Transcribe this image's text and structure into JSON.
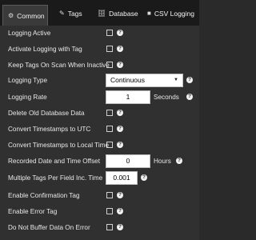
{
  "tabs": [
    {
      "label": "Common",
      "icon": "gear-icon",
      "glyph": "⚙",
      "active": true
    },
    {
      "label": "Tags",
      "icon": "tag-icon",
      "glyph": "✎",
      "active": false
    },
    {
      "label": "Database",
      "icon": "database-icon",
      "glyph": "🗄",
      "active": false
    },
    {
      "label": "CSV Logging",
      "icon": "csv-icon",
      "glyph": "■",
      "active": false
    }
  ],
  "settings": {
    "logging_active": {
      "label": "Logging Active",
      "checked": false
    },
    "activate_logging_with_tag": {
      "label": "Activate Logging with Tag",
      "checked": false
    },
    "keep_tags_on_scan": {
      "label": "Keep Tags On Scan When Inactive",
      "checked": false
    },
    "logging_type": {
      "label": "Logging Type",
      "value": "Continuous"
    },
    "logging_rate": {
      "label": "Logging Rate",
      "value": "1",
      "unit": "Seconds"
    },
    "delete_old_data": {
      "label": "Delete Old Database Data",
      "checked": false
    },
    "convert_utc": {
      "label": "Convert Timestamps to UTC",
      "checked": false
    },
    "convert_local": {
      "label": "Convert Timestamps to Local Time",
      "checked": false
    },
    "recorded_offset": {
      "label": "Recorded Date and Time Offset",
      "value": "0",
      "unit": "Hours"
    },
    "multiple_tags": {
      "label": "Multiple Tags Per Field Inc. Time",
      "value": "0.001"
    },
    "enable_confirmation": {
      "label": "Enable Confirmation Tag",
      "checked": false
    },
    "enable_error": {
      "label": "Enable Error Tag",
      "checked": false
    },
    "do_not_buffer": {
      "label": "Do Not Buffer Data On Error",
      "checked": false
    }
  },
  "help_glyph": "?"
}
